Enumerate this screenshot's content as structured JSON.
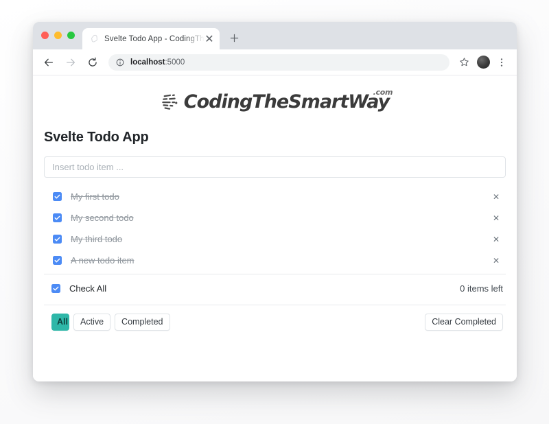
{
  "browser": {
    "traffic_lights": [
      "close",
      "minimize",
      "maximize"
    ],
    "tab": {
      "title": "Svelte Todo App - CodingTheS",
      "favicon_name": "svelte-logo-favicon",
      "close_label": "✕"
    },
    "new_tab_label": "+",
    "toolbar": {
      "back_label": "←",
      "forward_label": "→",
      "reload_label": "⟳",
      "url_host": "localhost",
      "url_port": ":5000",
      "info_label": "ⓘ",
      "bookmark_label": "☆",
      "menu_label": "⋮",
      "avatar_name": "profile-avatar"
    }
  },
  "page": {
    "logo": {
      "text": "CodingTheSmartWay",
      "suffix": ".com"
    },
    "title": "Svelte Todo App",
    "input": {
      "placeholder": "Insert todo item ...",
      "value": ""
    },
    "todos": [
      {
        "label": "My first todo",
        "completed": true,
        "delete_label": "✕"
      },
      {
        "label": "My second todo",
        "completed": true,
        "delete_label": "✕"
      },
      {
        "label": "My third todo",
        "completed": true,
        "delete_label": "✕"
      },
      {
        "label": "A new todo item",
        "completed": true,
        "delete_label": "✕"
      }
    ],
    "check_all": {
      "label": "Check All",
      "checked": true
    },
    "items_left": "0 items left",
    "filters": [
      {
        "label": "All",
        "active": true
      },
      {
        "label": "Active",
        "active": false
      },
      {
        "label": "Completed",
        "active": false
      }
    ],
    "clear_completed_label": "Clear Completed"
  },
  "colors": {
    "accent_active_filter": "#2eb7a8",
    "checkbox_blue": "#4c8bf5",
    "tabstrip": "#dee1e6",
    "text_dark": "#212529",
    "text_muted": "#8d949b"
  }
}
